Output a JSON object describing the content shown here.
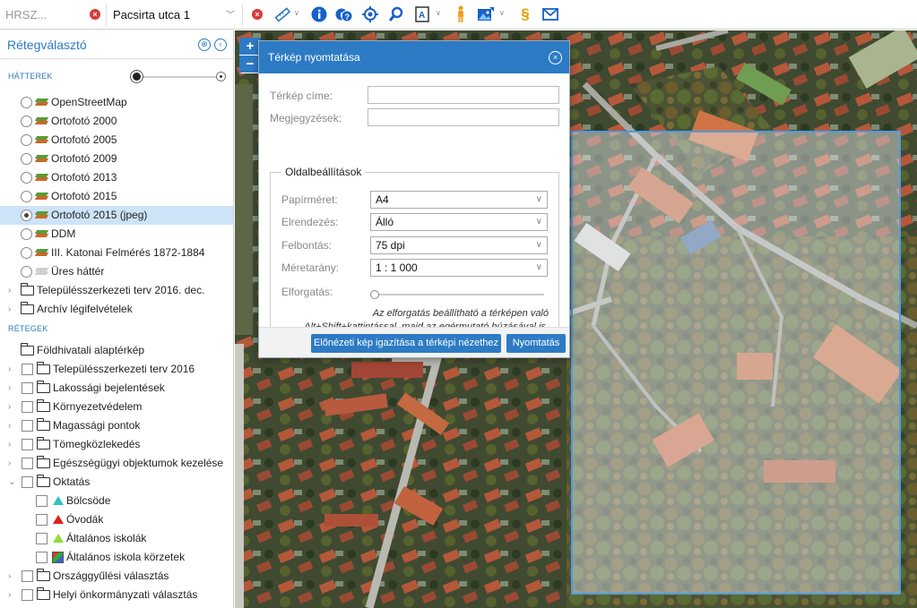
{
  "toolbar": {
    "hrsz_placeholder": "HRSZ...",
    "street_value": "Pacsirta utca 1",
    "icons": [
      "clear-icon",
      "clear-icon",
      "measure-icon",
      "info-icon",
      "query-icon",
      "locate-icon",
      "search-icon",
      "print-icon",
      "person-icon",
      "image-export-icon",
      "paragraph-icon",
      "mail-icon"
    ],
    "colors": {
      "accent": "#2d7bc4",
      "clear": "#d93a3a",
      "paragraph": "#e0a000",
      "person": "#f0a020"
    }
  },
  "sidebar": {
    "title": "Rétegválasztó",
    "backgrounds_label": "HÁTTEREK",
    "backgrounds": [
      {
        "label": "OpenStreetMap",
        "selected": false
      },
      {
        "label": "Ortofotó 2000",
        "selected": false
      },
      {
        "label": "Ortofotó 2005",
        "selected": false
      },
      {
        "label": "Ortofotó 2009",
        "selected": false
      },
      {
        "label": "Ortofotó 2013",
        "selected": false
      },
      {
        "label": "Ortofotó 2015",
        "selected": false
      },
      {
        "label": "Ortofotó 2015 (jpeg)",
        "selected": true
      },
      {
        "label": "DDM",
        "selected": false
      },
      {
        "label": "III. Katonai Felmérés 1872-1884",
        "selected": false
      },
      {
        "label": "Üres háttér",
        "selected": false
      }
    ],
    "bg_folders": [
      "Településszerkezeti terv 2016. dec.",
      "Archív légifelvételek"
    ],
    "layers_label": "RÉTEGEK",
    "layers": [
      {
        "label": "Földhivatali alaptérkép",
        "checkbox": false,
        "caret": false
      },
      {
        "label": "Településszerkezeti terv 2016",
        "checkbox": true,
        "caret": true
      },
      {
        "label": "Lakossági bejelentések",
        "checkbox": true,
        "caret": true
      },
      {
        "label": "Környezetvédelem",
        "checkbox": true,
        "caret": true
      },
      {
        "label": "Magassági pontok",
        "checkbox": true,
        "caret": true
      },
      {
        "label": "Tömegközlekedés",
        "checkbox": true,
        "caret": true
      },
      {
        "label": "Egészségügyi objektumok kezelése",
        "checkbox": true,
        "caret": true
      },
      {
        "label": "Oktatás",
        "checkbox": true,
        "caret": true,
        "expanded": true
      }
    ],
    "education_children": [
      "Bölcsöde",
      "Óvodák",
      "Általános iskolák",
      "Általános iskola körzetek"
    ],
    "more_layers": [
      "Országgyűlési választás",
      "Helyi önkormányzati választás"
    ]
  },
  "map": {
    "zoom_in": "+",
    "zoom_out": "−"
  },
  "dialog": {
    "title": "Térkép nyomtatása",
    "map_title_label": "Térkép címe:",
    "map_title_value": "",
    "notes_label": "Megjegyzések:",
    "notes_value": "",
    "page_settings": "Oldalbeállítások",
    "paper_label": "Papírméret:",
    "paper_value": "A4",
    "layout_label": "Elrendezés:",
    "layout_value": "Álló",
    "resolution_label": "Felbontás:",
    "resolution_value": "75 dpi",
    "scale_label": "Méretarány:",
    "scale_value": "1 : 1 000",
    "rotation_label": "Elforgatás:",
    "rotation_value": 0,
    "hint_line1": "Az elforgatás beállítható a térképen való",
    "hint_line2": "Alt+Shift+kattintással, majd az egérmutató húzásával is.",
    "fit_button": "Előnézeti kép igazítása a térképi nézethez",
    "print_button": "Nyomtatás"
  }
}
